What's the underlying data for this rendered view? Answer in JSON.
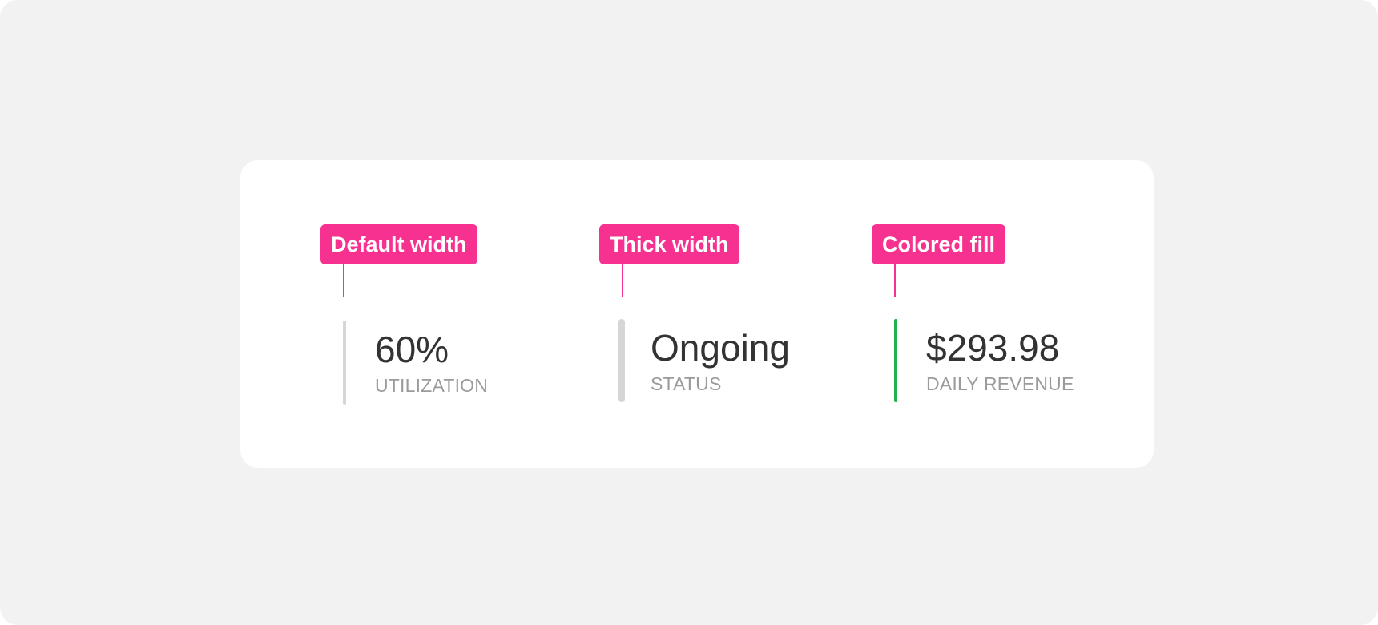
{
  "callouts": [
    {
      "label": "Default width"
    },
    {
      "label": "Thick width"
    },
    {
      "label": "Colored fill"
    }
  ],
  "stats": [
    {
      "value": "60%",
      "label": "UTILIZATION",
      "bar_color": "#d6d6d6",
      "bar_style": "default"
    },
    {
      "value": "Ongoing",
      "label": "STATUS",
      "bar_color": "#d6d6d6",
      "bar_style": "thick"
    },
    {
      "value": "$293.98",
      "label": "DAILY REVENUE",
      "bar_color": "#22b24c",
      "bar_style": "colored"
    }
  ],
  "colors": {
    "background": "#f2f2f2",
    "card": "#ffffff",
    "callout": "#f7318f",
    "value_text": "#333333",
    "label_text": "#9b9b9b"
  }
}
